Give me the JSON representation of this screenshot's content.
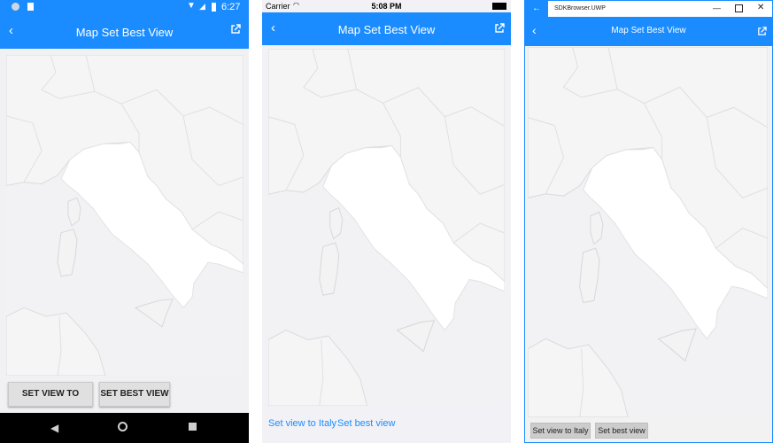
{
  "title": "Map Set Best View",
  "android": {
    "time": "6:27",
    "button_italy": "SET VIEW TO ITALY",
    "button_best": "SET BEST VIEW"
  },
  "ios": {
    "carrier": "Carrier",
    "time": "5:08 PM",
    "link_italy": "Set view to Italy",
    "link_best": "Set best view"
  },
  "uwp": {
    "window_title": "SDKBrowser.UWP",
    "button_italy": "Set view to Italy",
    "button_best": "Set best view"
  },
  "colors": {
    "accent": "#1a8cff",
    "map_land": "#f5f5f6",
    "map_highlight": "#ffffff"
  }
}
